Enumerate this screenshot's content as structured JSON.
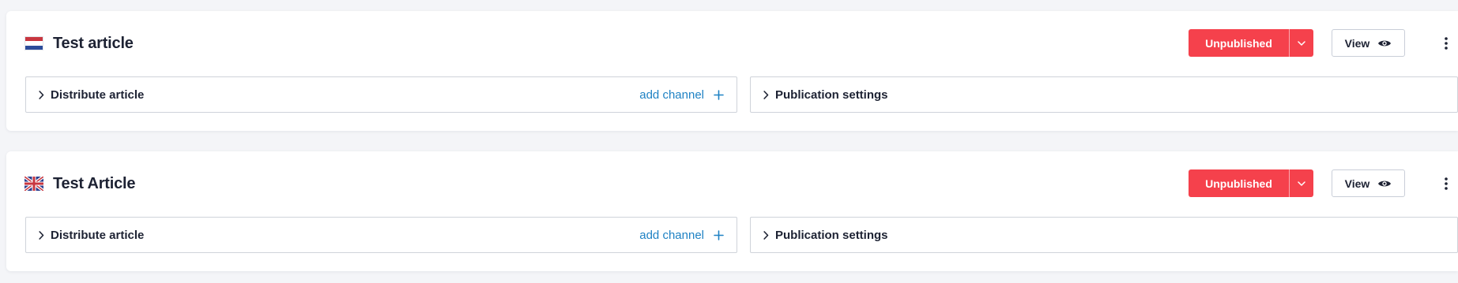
{
  "articles": [
    {
      "flag": "nl-flag-icon",
      "title": "Test article",
      "status_label": "Unpublished",
      "view_label": "View",
      "distribute_label": "Distribute article",
      "add_channel_label": "add channel",
      "publication_label": "Publication settings"
    },
    {
      "flag": "uk-flag-icon",
      "title": "Test Article",
      "status_label": "Unpublished",
      "view_label": "View",
      "distribute_label": "Distribute article",
      "add_channel_label": "add channel",
      "publication_label": "Publication settings"
    }
  ],
  "colors": {
    "status_red": "#f5414c",
    "link_blue": "#1f82c4",
    "text_dark": "#1d2233",
    "page_bg": "#f4f5f8"
  },
  "icons": {
    "caret": "chevron-down-icon",
    "view": "eye-icon",
    "menu": "more-vertical-icon",
    "expand": "chevron-right-icon",
    "add": "plus-icon"
  }
}
